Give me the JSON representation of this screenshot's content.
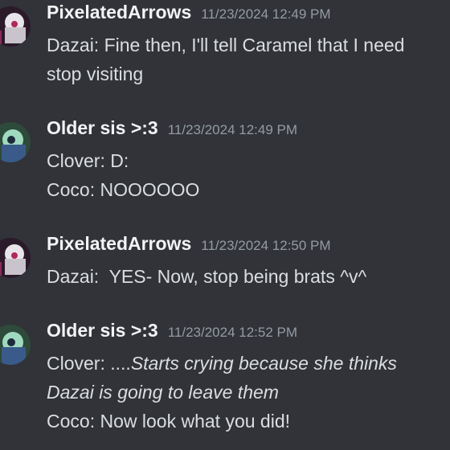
{
  "messages": [
    {
      "author": "PixelatedArrows",
      "timestamp": "11/23/2024 12:49 PM",
      "avatar": "pixelated-arrows-avatar",
      "lines": [
        {
          "speaker": "Dazai:",
          "text": " Fine then, I'll tell Caramel that I need",
          "italic": ""
        },
        {
          "speaker": "",
          "text": "stop visiting",
          "italic": ""
        }
      ]
    },
    {
      "author": "Older sis >:3",
      "timestamp": "11/23/2024 12:49 PM",
      "avatar": "older-sis-avatar",
      "lines": [
        {
          "speaker": "Clover:",
          "text": " D:",
          "italic": ""
        },
        {
          "speaker": "Coco:",
          "text": " NOOOOOO",
          "italic": ""
        }
      ]
    },
    {
      "author": "PixelatedArrows",
      "timestamp": "11/23/2024 12:50 PM",
      "avatar": "pixelated-arrows-avatar",
      "lines": [
        {
          "speaker": "Dazai:",
          "text": "  YES- Now, stop being brats ^v^",
          "italic": ""
        }
      ]
    },
    {
      "author": "Older sis >:3",
      "timestamp": "11/23/2024 12:52 PM",
      "avatar": "older-sis-avatar",
      "lines": [
        {
          "speaker": "Clover:",
          "text": " ....",
          "italic": "Starts crying because she thinks"
        },
        {
          "speaker": "",
          "text": "",
          "italic": "Dazai is going to leave them"
        },
        {
          "speaker": "Coco:",
          "text": " Now look what you did!",
          "italic": ""
        }
      ]
    }
  ],
  "colors": {
    "background": "#313338",
    "username": "#f2f3f5",
    "timestamp": "#949ba4",
    "text": "#dbdee1"
  }
}
